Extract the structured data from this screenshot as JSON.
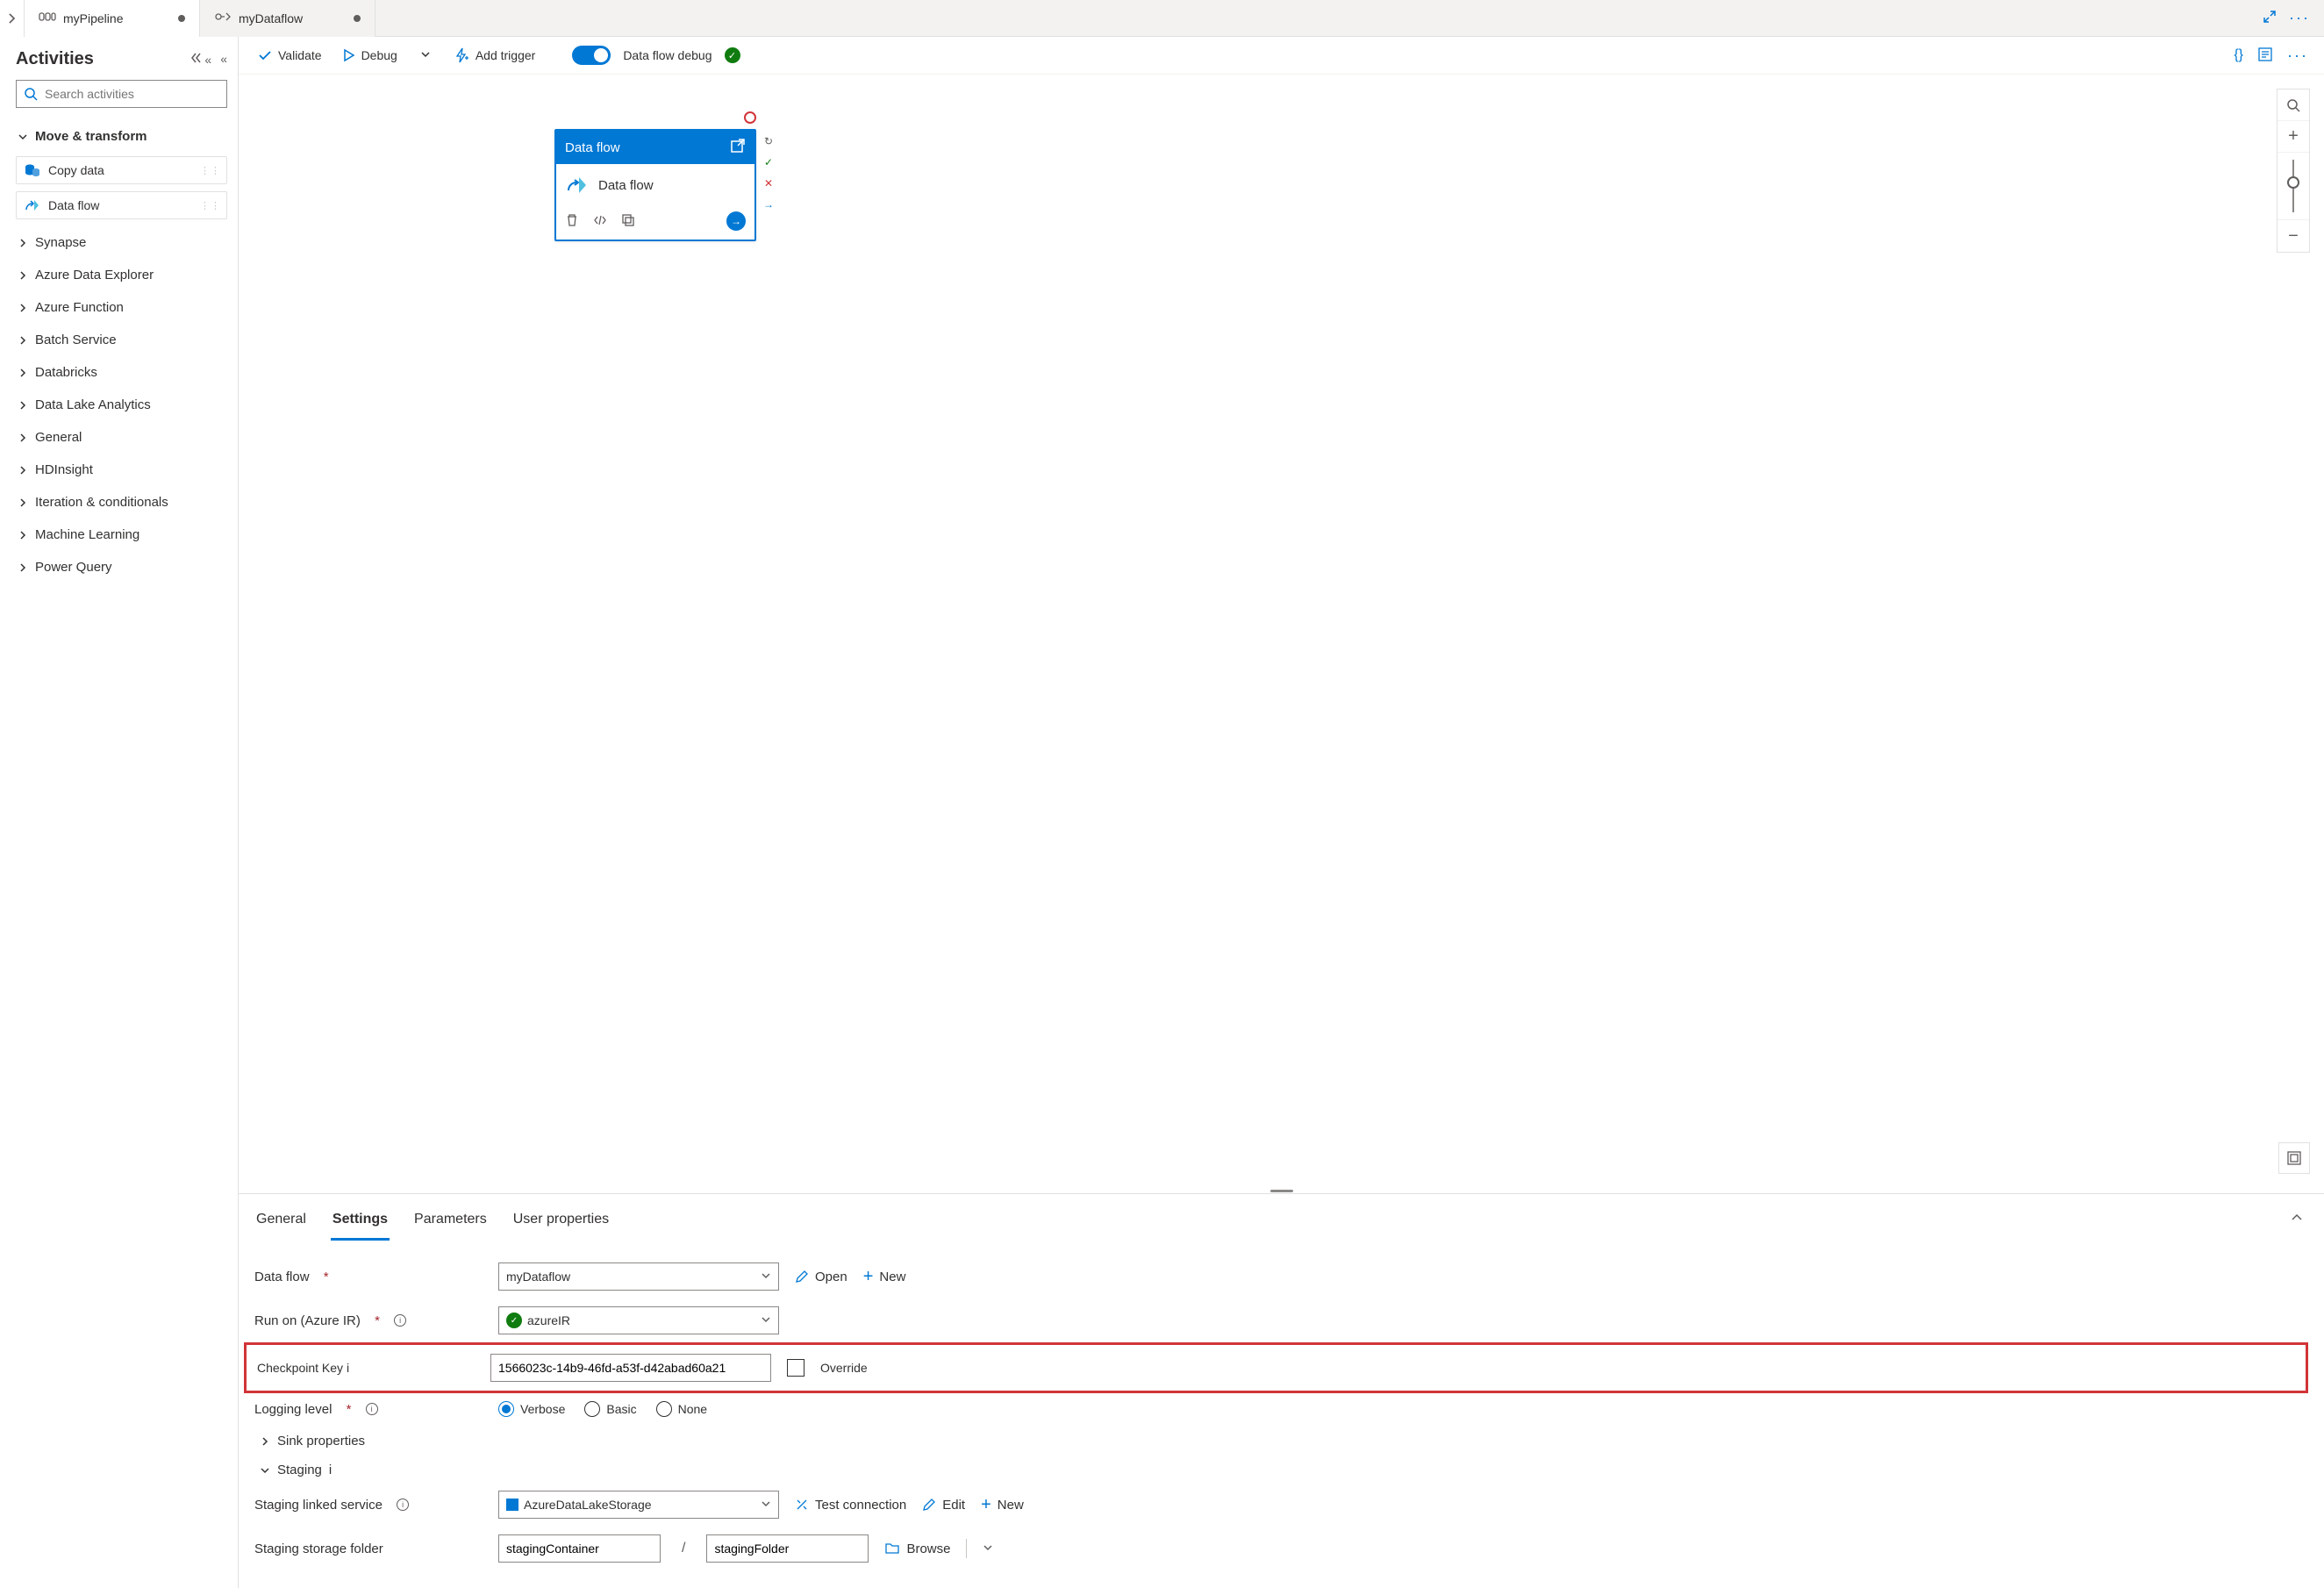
{
  "tabs": [
    {
      "label": "myPipeline",
      "dirty": true
    },
    {
      "label": "myDataflow",
      "dirty": true
    }
  ],
  "sidebar": {
    "title": "Activities",
    "search_placeholder": "Search activities",
    "move_transform": "Move & transform",
    "copy_data": "Copy data",
    "data_flow": "Data flow",
    "categories": [
      "Synapse",
      "Azure Data Explorer",
      "Azure Function",
      "Batch Service",
      "Databricks",
      "Data Lake Analytics",
      "General",
      "HDInsight",
      "Iteration & conditionals",
      "Machine Learning",
      "Power Query"
    ]
  },
  "toolbar": {
    "validate": "Validate",
    "debug": "Debug",
    "add_trigger": "Add trigger",
    "data_flow_debug": "Data flow debug"
  },
  "node": {
    "header": "Data flow",
    "body": "Data flow"
  },
  "prop_tabs": [
    "General",
    "Settings",
    "Parameters",
    "User properties"
  ],
  "form": {
    "data_flow_label": "Data flow",
    "data_flow_value": "myDataflow",
    "open": "Open",
    "new": "New",
    "run_on_label": "Run on (Azure IR)",
    "run_on_value": "azureIR",
    "checkpoint_label": "Checkpoint Key",
    "checkpoint_value": "1566023c-14b9-46fd-a53f-d42abad60a21",
    "override_label": "Override",
    "logging_label": "Logging level",
    "logging_options": [
      "Verbose",
      "Basic",
      "None"
    ],
    "sink_props": "Sink properties",
    "staging": "Staging",
    "staging_service_label": "Staging linked service",
    "staging_service_value": "AzureDataLakeStorage",
    "test_conn": "Test connection",
    "edit": "Edit",
    "staging_folder_label": "Staging storage folder",
    "staging_container": "stagingContainer",
    "staging_folder": "stagingFolder",
    "browse": "Browse"
  }
}
